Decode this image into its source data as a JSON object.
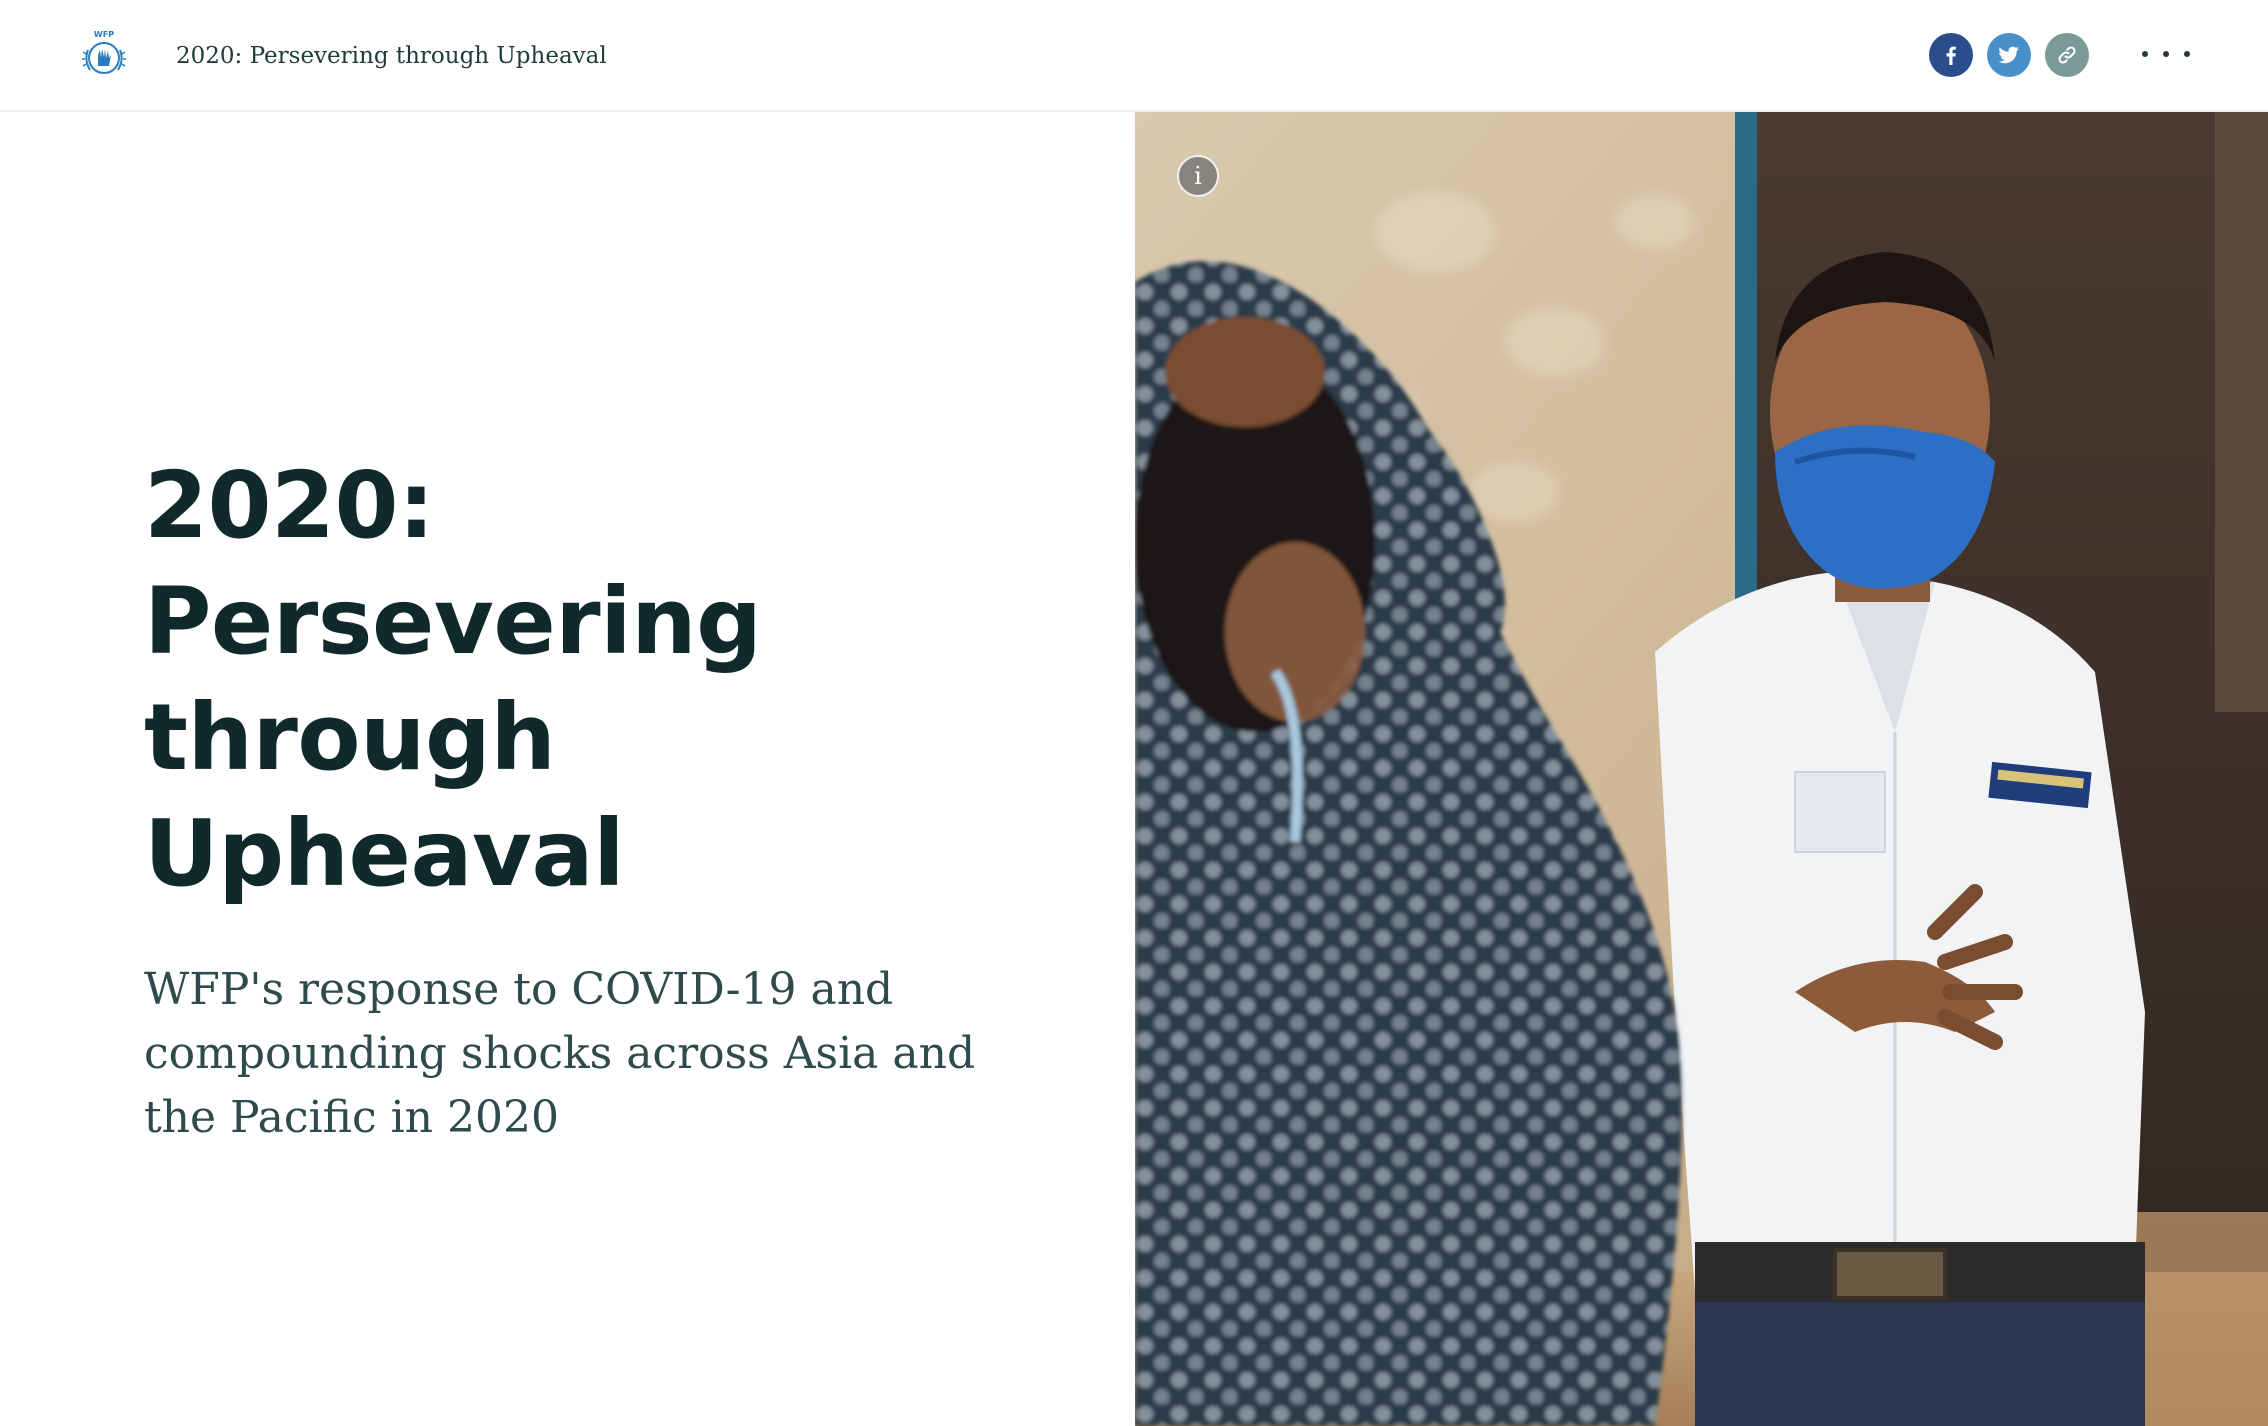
{
  "header": {
    "logo_label": "WFP",
    "title": "2020: Persevering through Upheaval",
    "share": {
      "facebook_icon": "facebook-icon",
      "twitter_icon": "twitter-icon",
      "link_icon": "link-icon",
      "more_icon": "more-horizontal-icon"
    }
  },
  "hero": {
    "title": "2020: Persevering through Upheaval",
    "subtitle": "WFP's response to COVID-19 and compounding shocks across Asia and the Pacific in 2020",
    "image": {
      "info_icon": "info-icon",
      "info_glyph": "i"
    }
  },
  "colors": {
    "title_text": "#102a2c",
    "subtitle_text": "#2e4a4b",
    "facebook": "#2a4e8c",
    "twitter": "#4a90c8",
    "link": "#7a9a98",
    "wfp_blue": "#2b7bc0"
  }
}
